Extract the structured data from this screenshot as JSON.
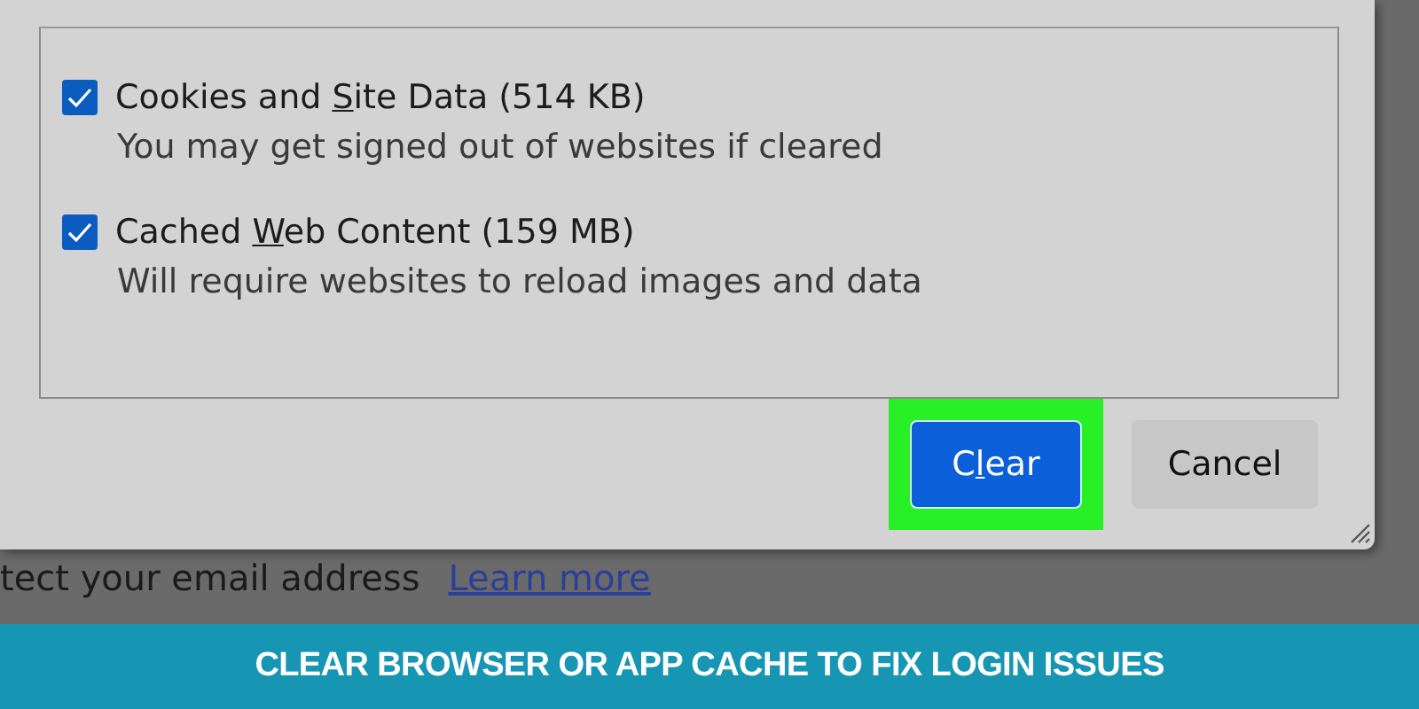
{
  "dialog": {
    "options": [
      {
        "label": {
          "before": "Cookies and ",
          "key": "S",
          "after": "ite Data (514 KB)"
        },
        "description": "You may get signed out of websites if cleared",
        "checked": true
      },
      {
        "label": {
          "before": "Cached ",
          "key": "W",
          "after": "eb Content (159 MB)"
        },
        "description": "Will require websites to reload images and data",
        "checked": true
      }
    ],
    "buttons": [
      {
        "kind": "primary",
        "highlighted": true,
        "label": {
          "before": "C",
          "key": "l",
          "after": "ear"
        }
      },
      {
        "kind": "secondary",
        "highlighted": false,
        "label": {
          "before": "Cancel"
        }
      }
    ]
  },
  "page": {
    "text": "tect your email address",
    "link": "Learn more"
  },
  "caption": "CLEAR BROWSER OR APP CACHE TO FIX LOGIN ISSUES"
}
